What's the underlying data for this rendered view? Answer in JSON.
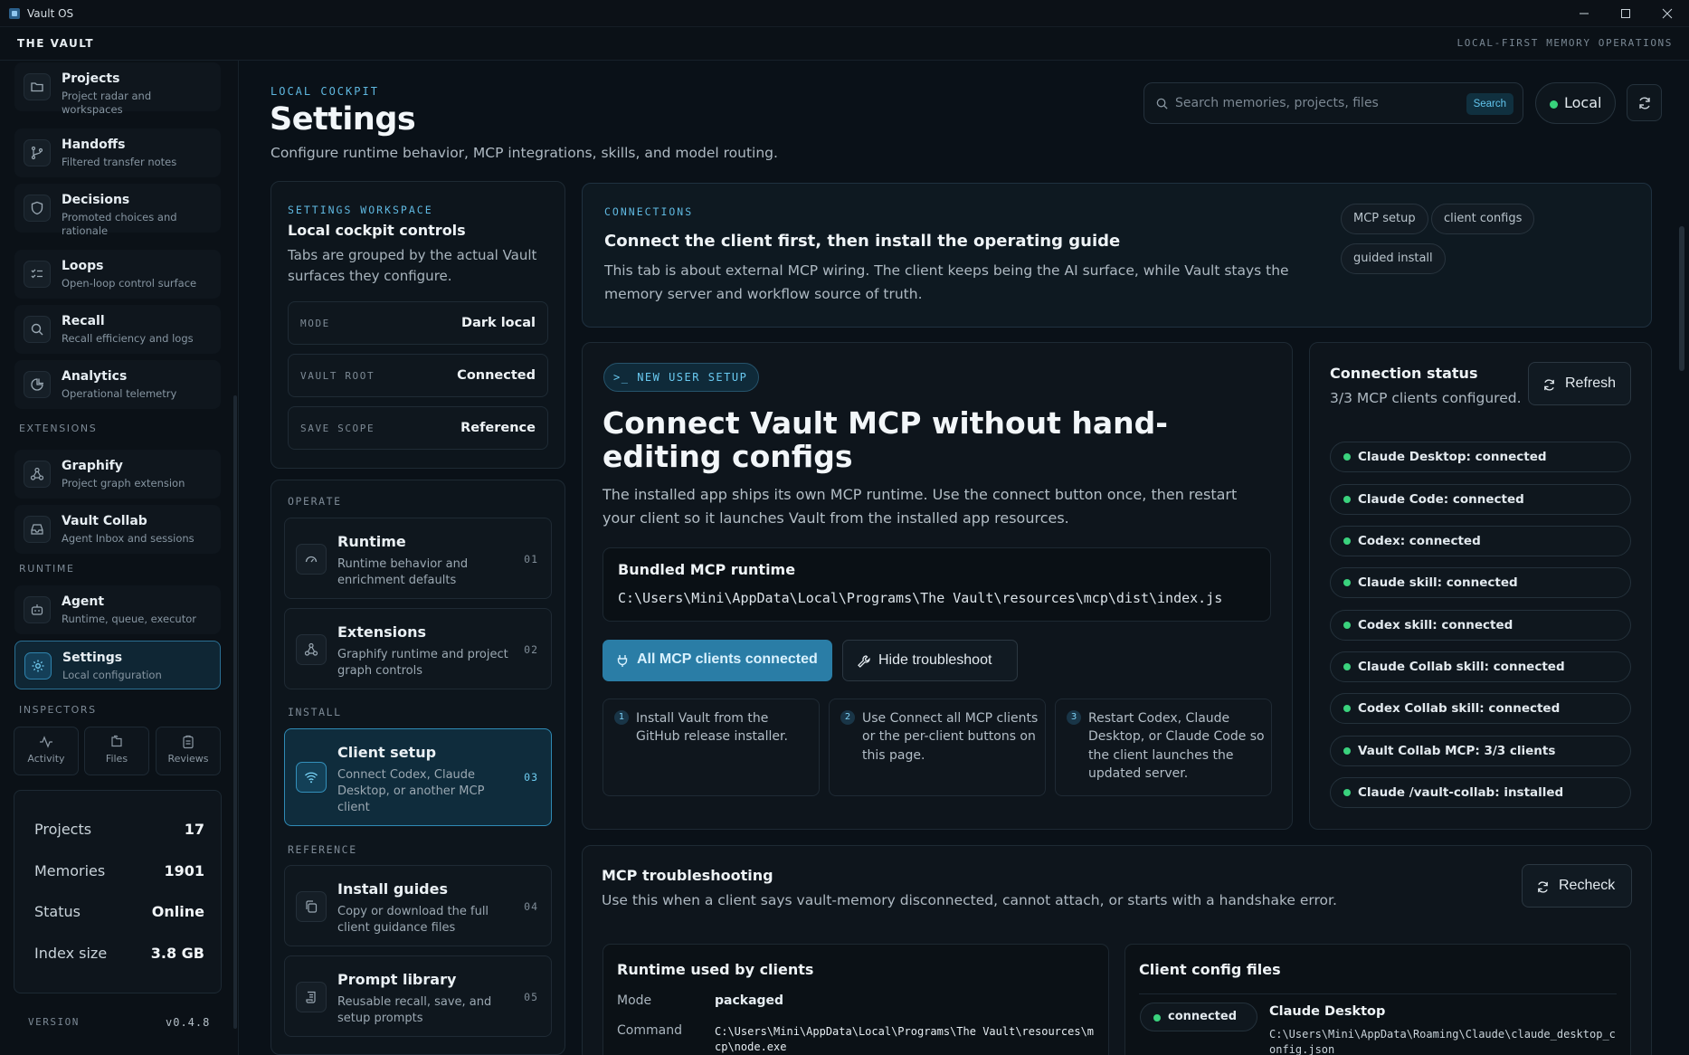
{
  "window": {
    "title": "Vault OS"
  },
  "header": {
    "brand": "THE VAULT",
    "tagline": "LOCAL-FIRST MEMORY OPERATIONS"
  },
  "sidebar": {
    "items": [
      {
        "title": "Projects",
        "subtitle": "Project radar and workspaces",
        "icon": "folder-icon"
      },
      {
        "title": "Handoffs",
        "subtitle": "Filtered transfer notes",
        "icon": "git-branch-icon"
      },
      {
        "title": "Decisions",
        "subtitle": "Promoted choices and rationale",
        "icon": "shield-icon"
      },
      {
        "title": "Loops",
        "subtitle": "Open-loop control surface",
        "icon": "list-check-icon"
      },
      {
        "title": "Recall",
        "subtitle": "Recall efficiency and logs",
        "icon": "search-icon"
      },
      {
        "title": "Analytics",
        "subtitle": "Operational telemetry",
        "icon": "analytics-icon"
      }
    ],
    "extensions_label": "EXTENSIONS",
    "extensions": [
      {
        "title": "Graphify",
        "subtitle": "Project graph extension",
        "icon": "graph-nodes-icon"
      },
      {
        "title": "Vault Collab",
        "subtitle": "Agent Inbox and sessions",
        "icon": "inbox-icon"
      }
    ],
    "runtime_label": "RUNTIME",
    "runtime": [
      {
        "title": "Agent",
        "subtitle": "Runtime, queue, executor",
        "icon": "bot-icon"
      },
      {
        "title": "Settings",
        "subtitle": "Local configuration",
        "icon": "gear-icon"
      }
    ],
    "inspectors_label": "INSPECTORS",
    "inspectors": [
      {
        "label": "Activity",
        "icon": "activity-icon"
      },
      {
        "label": "Files",
        "icon": "files-icon"
      },
      {
        "label": "Reviews",
        "icon": "clipboard-icon"
      }
    ],
    "stats": [
      {
        "label": "Projects",
        "value": "17"
      },
      {
        "label": "Memories",
        "value": "1901"
      },
      {
        "label": "Status",
        "value": "Online"
      },
      {
        "label": "Index size",
        "value": "3.8 GB"
      }
    ],
    "version_label": "VERSION",
    "version": "v0.4.8"
  },
  "page": {
    "eyebrow": "LOCAL COCKPIT",
    "title": "Settings",
    "subtitle": "Configure runtime behavior, MCP integrations, skills, and model routing."
  },
  "search": {
    "placeholder": "Search memories, projects, files",
    "button": "Search"
  },
  "mode_toggle": {
    "label": "Local",
    "color": "#38d27b"
  },
  "workspace": {
    "eyebrow": "SETTINGS WORKSPACE",
    "title": "Local cockpit controls",
    "description": "Tabs are grouped by the actual Vault surfaces they configure.",
    "fields": [
      {
        "key": "MODE",
        "value": "Dark local"
      },
      {
        "key": "VAULT ROOT",
        "value": "Connected"
      },
      {
        "key": "SAVE SCOPE",
        "value": "Reference"
      }
    ],
    "groups": {
      "operate": "OPERATE",
      "install": "INSTALL",
      "reference": "REFERENCE"
    },
    "tabs": [
      {
        "title": "Runtime",
        "subtitle": "Runtime behavior and enrichment defaults",
        "num": "01",
        "icon": "gauge-icon"
      },
      {
        "title": "Extensions",
        "subtitle": "Graphify runtime and project graph controls",
        "num": "02",
        "icon": "graph-nodes-icon"
      },
      {
        "title": "Client setup",
        "subtitle": "Connect Codex, Claude Desktop, or another MCP client",
        "num": "03",
        "icon": "wifi-icon"
      },
      {
        "title": "Install guides",
        "subtitle": "Copy or download the full client guidance files",
        "num": "04",
        "icon": "copy-icon"
      },
      {
        "title": "Prompt library",
        "subtitle": "Reusable recall, save, and setup prompts",
        "num": "05",
        "icon": "scroll-icon"
      }
    ]
  },
  "connections": {
    "eyebrow": "CONNECTIONS",
    "title": "Connect the client first, then install the operating guide",
    "description": "This tab is about external MCP wiring. The client keeps being the AI surface, while Vault stays the memory server and workflow source of truth.",
    "chips": [
      "MCP setup",
      "client configs",
      "guided install"
    ]
  },
  "setup": {
    "badge": "NEW USER SETUP",
    "title": "Connect Vault MCP without hand-editing configs",
    "description": "The installed app ships its own MCP runtime. Use the connect button once, then restart your client so it launches Vault from the installed app resources.",
    "bundle_title": "Bundled MCP runtime",
    "bundle_path": "C:\\Users\\Mini\\AppData\\Local\\Programs\\The Vault\\resources\\mcp\\dist\\index.js",
    "primary_button": "All MCP clients connected",
    "secondary_button": "Hide troubleshoot",
    "steps": [
      {
        "num": "1",
        "text": "Install Vault from the GitHub release installer."
      },
      {
        "num": "2",
        "text": "Use Connect all MCP clients or the per-client buttons on this page."
      },
      {
        "num": "3",
        "text": "Restart Codex, Claude Desktop, or Claude Code so the client launches the updated server."
      }
    ]
  },
  "status": {
    "title": "Connection status",
    "subtitle": "3/3 MCP clients configured.",
    "refresh": "Refresh",
    "items": [
      "Claude Desktop: connected",
      "Claude Code: connected",
      "Codex: connected",
      "Claude skill: connected",
      "Codex skill: connected",
      "Claude Collab skill: connected",
      "Codex Collab skill: connected",
      "Vault Collab MCP: 3/3 clients",
      "Claude /vault-collab: installed"
    ]
  },
  "troubleshoot": {
    "title": "MCP troubleshooting",
    "description": "Use this when a client says vault-memory disconnected, cannot attach, or starts with a handshake error.",
    "recheck": "Recheck",
    "runtime": {
      "title": "Runtime used by clients",
      "mode_label": "Mode",
      "mode": "packaged",
      "command_label": "Command",
      "command": "C:\\Users\\Mini\\AppData\\Local\\Programs\\The Vault\\resources\\mcp\\node.exe"
    },
    "config_files": {
      "title": "Client config files",
      "badge": "connected",
      "client": "Claude Desktop",
      "path": "C:\\Users\\Mini\\AppData\\Roaming\\Claude\\claude_desktop_config.json"
    }
  }
}
